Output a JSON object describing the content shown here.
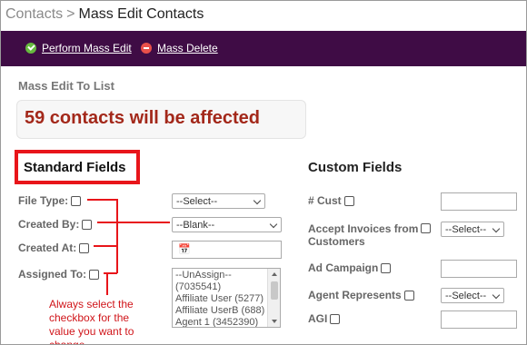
{
  "breadcrumb": {
    "parent": "Contacts",
    "separator": ">",
    "current": "Mass Edit Contacts"
  },
  "toolbar": {
    "perform_label": "Perform Mass Edit",
    "delete_label": "Mass Delete"
  },
  "subtitle": "Mass Edit To List",
  "affected_text": "59 contacts will be affected",
  "standard": {
    "title": "Standard Fields",
    "file_type": {
      "label": "File Type:",
      "value": "--Select--"
    },
    "created_by": {
      "label": "Created By:",
      "value": "--Blank--"
    },
    "created_at": {
      "label": "Created At:",
      "icon": "calendar-icon"
    },
    "assigned_to": {
      "label": "Assigned To:",
      "options": [
        "--UnAssign--",
        "(7035541)",
        "Affiliate User (5277)",
        "Affiliate UserB (688)",
        "Agent 1 (3452390)"
      ]
    }
  },
  "custom": {
    "title": "Custom Fields",
    "cust": {
      "label": "# Cust"
    },
    "accept": {
      "label_line1": "Accept Invoices from",
      "label_line2": "Customers",
      "value": "--Select--"
    },
    "ad": {
      "label": "Ad Campaign"
    },
    "agent": {
      "label": "Agent Represents",
      "value": "--Select--"
    },
    "agi": {
      "label": "AGI"
    }
  },
  "annotation": {
    "text": "Always select the checkbox for the value you want to change.",
    "color": "#d0151a"
  },
  "colors": {
    "toolbar_bg": "#3f0c45",
    "affected_text": "#a3281a",
    "highlight": "#e8151a"
  }
}
